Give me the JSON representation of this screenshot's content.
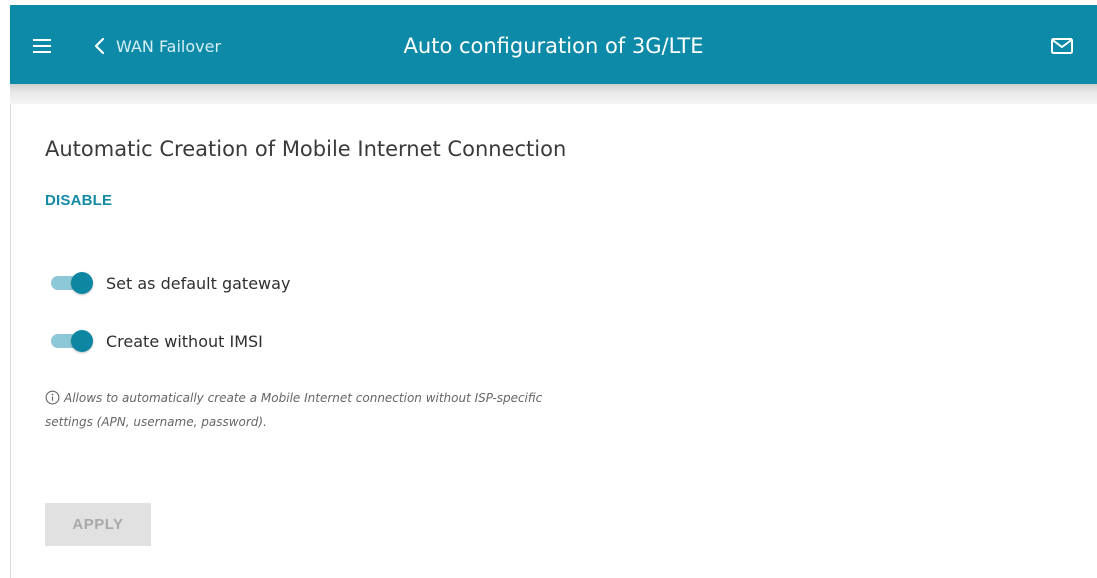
{
  "header": {
    "back_label": "WAN Failover",
    "title": "Auto configuration of 3G/LTE",
    "menu_icon": "hamburger-menu-icon",
    "back_icon": "chevron-left-icon",
    "mail_icon": "envelope-icon",
    "background_color": "#0d8aa8"
  },
  "main": {
    "section_title": "Automatic Creation of Mobile Internet Connection",
    "disable_label": "DISABLE",
    "toggles": [
      {
        "label": "Set as default gateway",
        "checked": true
      },
      {
        "label": "Create without IMSI",
        "checked": true
      }
    ],
    "hint": "Allows to automatically create a Mobile Internet connection without ISP-specific settings (APN, username, password).",
    "hint_icon": "info-icon",
    "apply_label": "APPLY",
    "apply_enabled": false,
    "accent_color": "#138aa6"
  }
}
